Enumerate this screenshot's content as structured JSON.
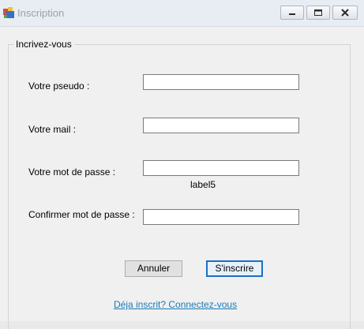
{
  "window": {
    "title": "Inscription",
    "icon": "winforms-app-icon"
  },
  "form": {
    "group_title": "Incrivez-vous",
    "fields": {
      "pseudo": {
        "label": "Votre pseudo :",
        "value": ""
      },
      "mail": {
        "label": "Votre mail :",
        "value": ""
      },
      "password": {
        "label": "Votre mot de passe :",
        "value": ""
      },
      "confirm": {
        "label": "Confirmer mot de passe :",
        "value": ""
      }
    },
    "label5": "label5",
    "buttons": {
      "cancel": "Annuler",
      "submit": "S'inscrire"
    },
    "login_link": "Déja inscrit? Connectez-vous"
  },
  "colors": {
    "accent_border": "#1e6fbf",
    "link": "#1a7ab5"
  }
}
